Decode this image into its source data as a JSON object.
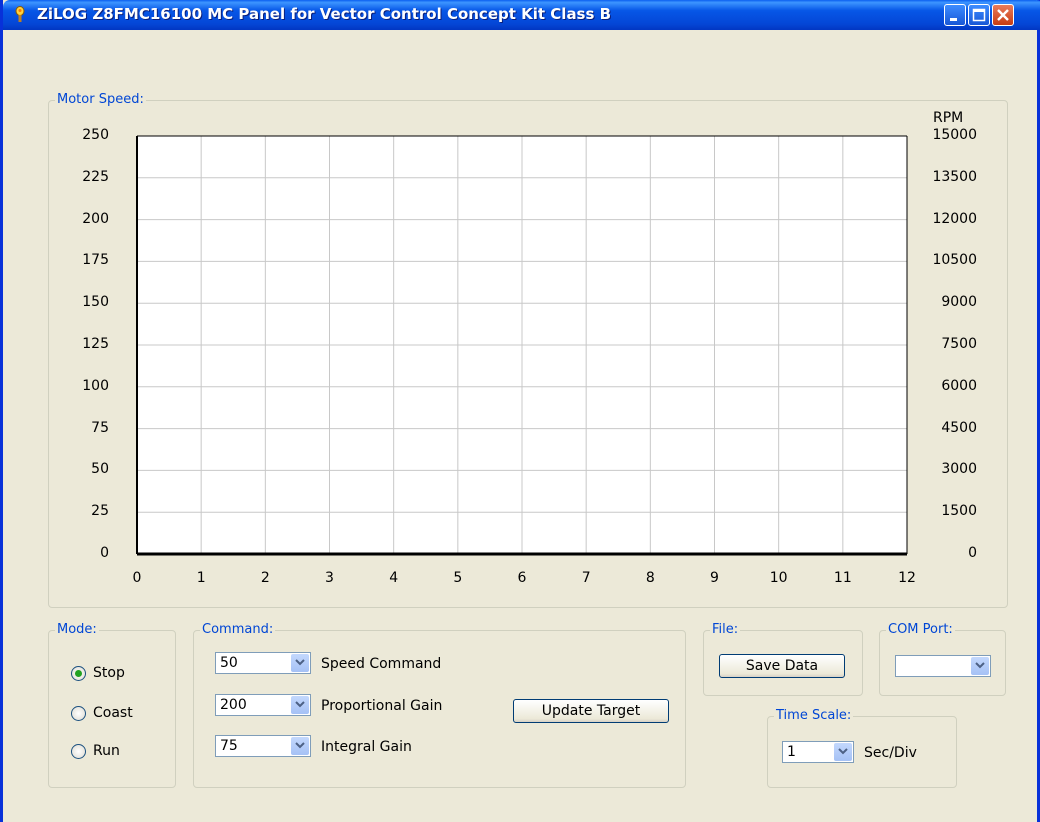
{
  "window": {
    "title": "ZiLOG Z8FMC16100 MC Panel for Vector Control Concept Kit Class B",
    "controls": [
      "minimize",
      "maximize",
      "close"
    ]
  },
  "motor_speed": {
    "group_label": "Motor Speed:",
    "right_axis_unit": "RPM"
  },
  "chart_data": {
    "type": "line",
    "series": [],
    "x_ticks": [
      "0",
      "1",
      "2",
      "3",
      "4",
      "5",
      "6",
      "7",
      "8",
      "9",
      "10",
      "11",
      "12"
    ],
    "xlim": [
      0,
      12
    ],
    "y_left_ticks": [
      "250",
      "225",
      "200",
      "175",
      "150",
      "125",
      "100",
      "75",
      "50",
      "25",
      "0"
    ],
    "ylim_left": [
      0,
      250
    ],
    "y_right_label": "RPM",
    "y_right_ticks": [
      "15000",
      "13500",
      "12000",
      "10500",
      "9000",
      "7500",
      "6000",
      "4500",
      "3000",
      "1500",
      "0"
    ],
    "ylim_right": [
      0,
      15000
    ],
    "grid": true
  },
  "mode": {
    "group_label": "Mode:",
    "options": [
      {
        "label": "Stop",
        "selected": true
      },
      {
        "label": "Coast",
        "selected": false
      },
      {
        "label": "Run",
        "selected": false
      }
    ]
  },
  "command": {
    "group_label": "Command:",
    "speed_command": {
      "value": "50",
      "label": "Speed Command"
    },
    "proportional_gain": {
      "value": "200",
      "label": "Proportional Gain"
    },
    "integral_gain": {
      "value": "75",
      "label": "Integral Gain"
    },
    "update_button": "Update Target"
  },
  "file": {
    "group_label": "File:",
    "save_button": "Save Data"
  },
  "com_port": {
    "group_label": "COM Port:",
    "value": ""
  },
  "time_scale": {
    "group_label": "Time Scale:",
    "value": "1",
    "unit": "Sec/Div"
  },
  "colors": {
    "titlebar": "#0054e3",
    "face": "#ece9d8",
    "group_label": "#0046d5",
    "grid": "#c8c8c8",
    "radio_dot": "#21a121"
  }
}
